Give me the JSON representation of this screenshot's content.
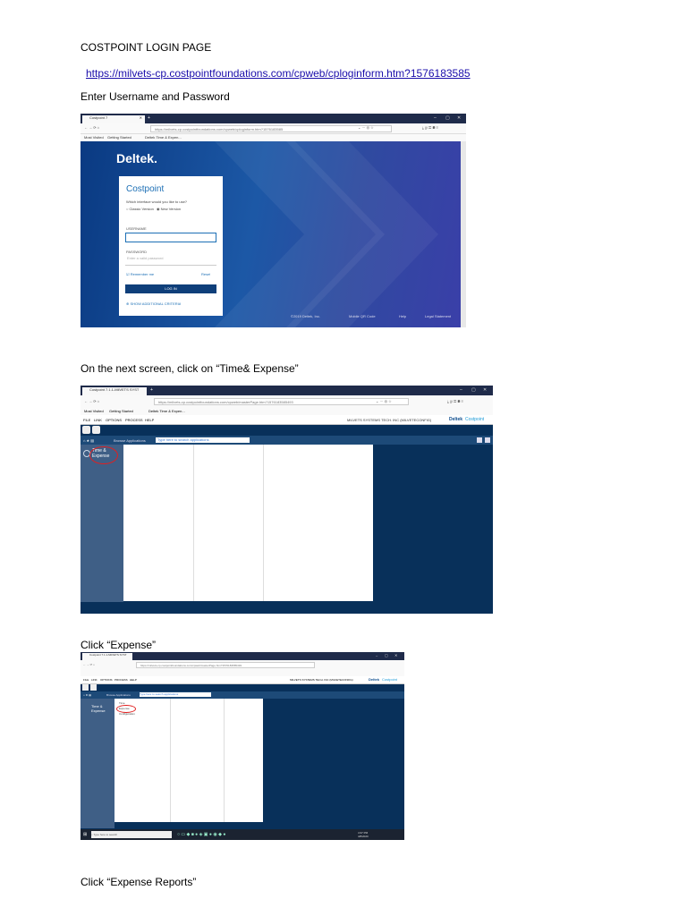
{
  "doc": {
    "heading": "COSTPOINT LOGIN PAGE",
    "link": "https://milvets-cp.costpointfoundations.com/cpweb/cploginform.htm?1576183585",
    "step1": "Enter Username and Password",
    "step2": "On the next screen, click on “Time& Expense”",
    "step3": "Click “Expense”",
    "step4": "Click “Expense Reports”"
  },
  "shot1": {
    "tab_title": "Costpoint 7",
    "url": "https://milvets-cp.costpointfoundations.com/cpweb/cploginform.htm?1576183585",
    "bookmarks": [
      "Most Visited",
      "Getting Started",
      "Deltek Time & Expen..."
    ],
    "logo": "Deltek.",
    "brand": "Costpoint",
    "question": "Which interface would you like to use?",
    "options": [
      "Classic Version",
      "New Version"
    ],
    "username_label": "USERNAME",
    "password_label": "PASSWORD",
    "password_placeholder": "Enter a valid password",
    "remember": "Remember me",
    "reset": "Reset",
    "login": "LOG IN",
    "additional": "SHOW ADDITIONAL CRITERIA",
    "footer": [
      "©2019 Deltek, Inc.",
      "Mobile QR Code",
      "Help",
      "Legal Statement"
    ],
    "colors": {
      "bg_start": "#0a3a82",
      "bg_end": "#3a3fa8",
      "accent": "#1c6fb5"
    }
  },
  "shot2": {
    "tab_title": "Costpoint 7.1.1-MilVETS SYST",
    "url": "https://milvets-cp.costpointfoundations.com/cpweb/masterPage.htm?1576183585493",
    "bookmarks": [
      "Most Visited",
      "Getting Started",
      "Deltek Time & Expen..."
    ],
    "menu": [
      "FILE",
      "LINK",
      "OPTIONS",
      "PROCESS",
      "HELP"
    ],
    "company": "MILVETS SYSTEMS TECH. INC (MILVETECONFIG)",
    "logo_deltek": "Deltek",
    "logo_cp": "Costpoint",
    "browse": "Browse Applications",
    "search_placeholder": "Type here to search applications",
    "nav_item": "Time & Expense"
  },
  "shot3": {
    "tab_title": "Costpoint 7.1.1-MilVETS SYST",
    "url": "https://milvets-cp.costpointfoundations.com/cpweb/masterPage.htm?1576183585493",
    "menu": [
      "FILE",
      "LINK",
      "OPTIONS",
      "PROCESS",
      "HELP"
    ],
    "company": "MILVETS SYSTEMS TECH. INC (MILVETECONFIG)",
    "logo_deltek": "Deltek",
    "logo_cp": "Costpoint",
    "browse": "Browse Applications",
    "search_placeholder": "Type here to search applications",
    "nav_item": "Time & Expense",
    "sub_items": [
      "Time",
      "Expense",
      "Configuration"
    ],
    "taskbar_search": "Type here to search",
    "clock": [
      "4:37 PM",
      "4/8/2020"
    ]
  }
}
